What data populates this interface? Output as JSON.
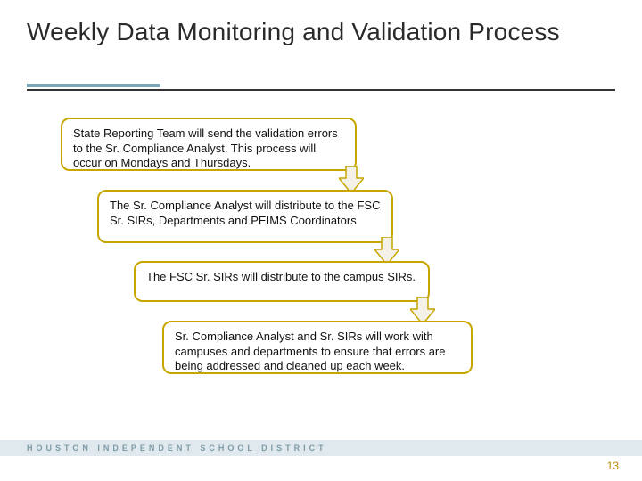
{
  "title": "Weekly Data Monitoring and Validation Process",
  "steps": [
    "State Reporting Team will send the validation errors to the Sr. Compliance Analyst. This process will occur on Mondays and Thursdays.",
    "The Sr. Compliance Analyst will distribute to the FSC Sr. SIRs, Departments and PEIMS Coordinators",
    "The FSC Sr. SIRs will distribute to the campus SIRs.",
    "Sr. Compliance Analyst and Sr. SIRs will work with campuses and departments to ensure that errors are being addressed and cleaned up each week."
  ],
  "footer": "HOUSTON INDEPENDENT SCHOOL DISTRICT",
  "page_number": "13"
}
